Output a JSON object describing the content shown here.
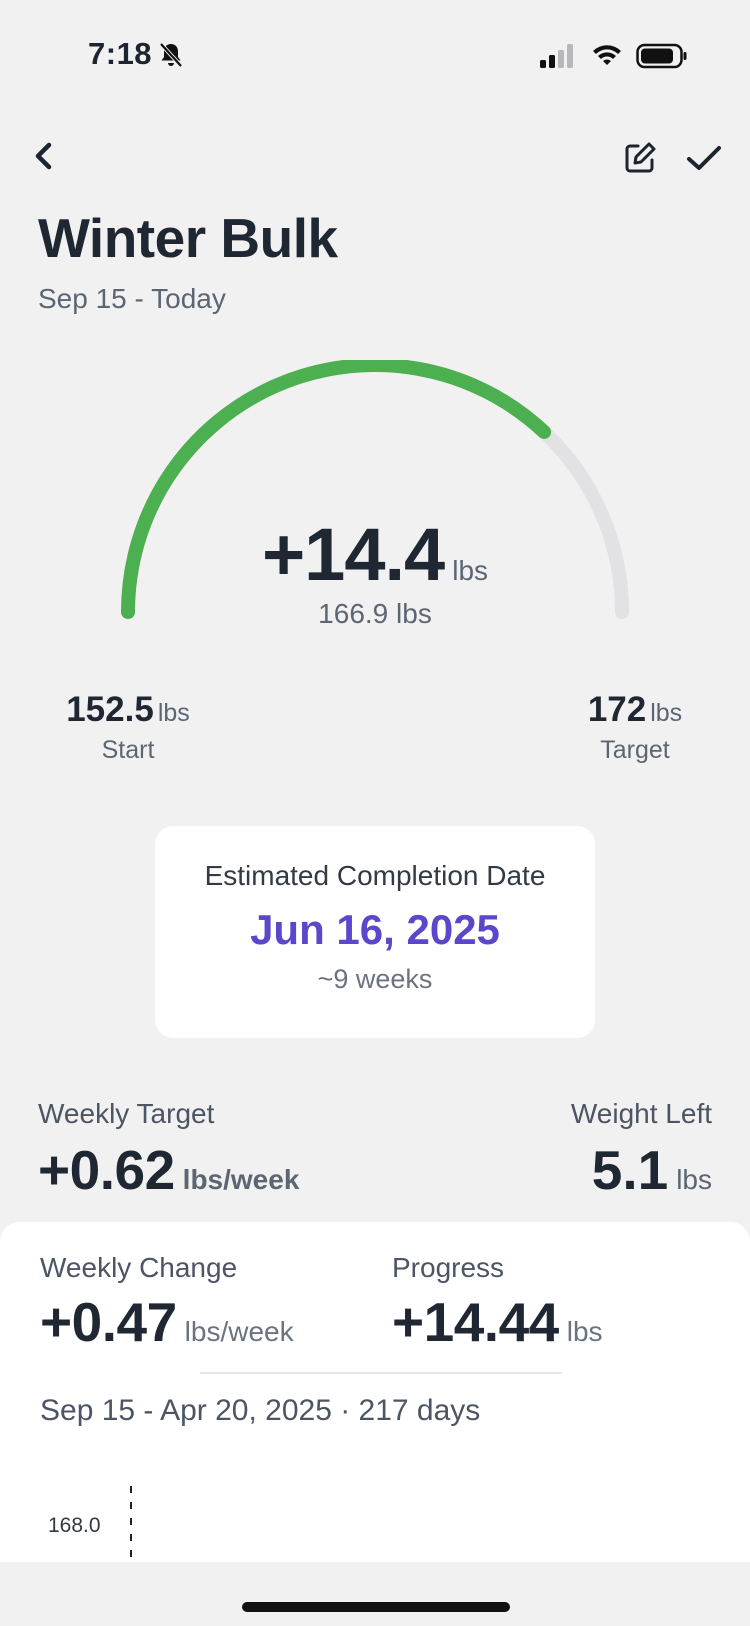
{
  "status_bar": {
    "time": "7:18"
  },
  "nav": {
    "back_icon": "chevron-left-icon",
    "edit_icon": "edit-icon",
    "confirm_icon": "checkmark-icon"
  },
  "header": {
    "title": "Winter Bulk",
    "subtitle": "Sep 15 - Today"
  },
  "gauge": {
    "change": "+14.4",
    "change_unit": "lbs",
    "current": "166.9 lbs",
    "progress_fraction": 0.74,
    "fill_color": "#4caf50",
    "track_color": "#e2e2e4",
    "start": {
      "value": "152.5",
      "unit": "lbs",
      "label": "Start"
    },
    "target": {
      "value": "172",
      "unit": "lbs",
      "label": "Target"
    }
  },
  "completion": {
    "label": "Estimated Completion Date",
    "date": "Jun 16, 2025",
    "weeks": "~9 weeks",
    "accent": "#5b46cc"
  },
  "weekly_target": {
    "label": "Weekly Target",
    "value": "+0.62",
    "unit": "lbs/week"
  },
  "weight_left": {
    "label": "Weight Left",
    "value": "5.1",
    "unit": "lbs"
  },
  "stats": {
    "weekly_change": {
      "label": "Weekly Change",
      "value": "+0.47",
      "unit": "lbs/week"
    },
    "progress": {
      "label": "Progress",
      "value": "+14.44",
      "unit": "lbs"
    },
    "range": "Sep 15 - Apr 20, 2025 · 217 days"
  },
  "chart_data": {
    "type": "line",
    "y_tick_labels": [
      "168.0"
    ],
    "series": [
      {
        "color": "#9a9a9e"
      },
      {
        "color": "#5b46cc"
      }
    ]
  }
}
